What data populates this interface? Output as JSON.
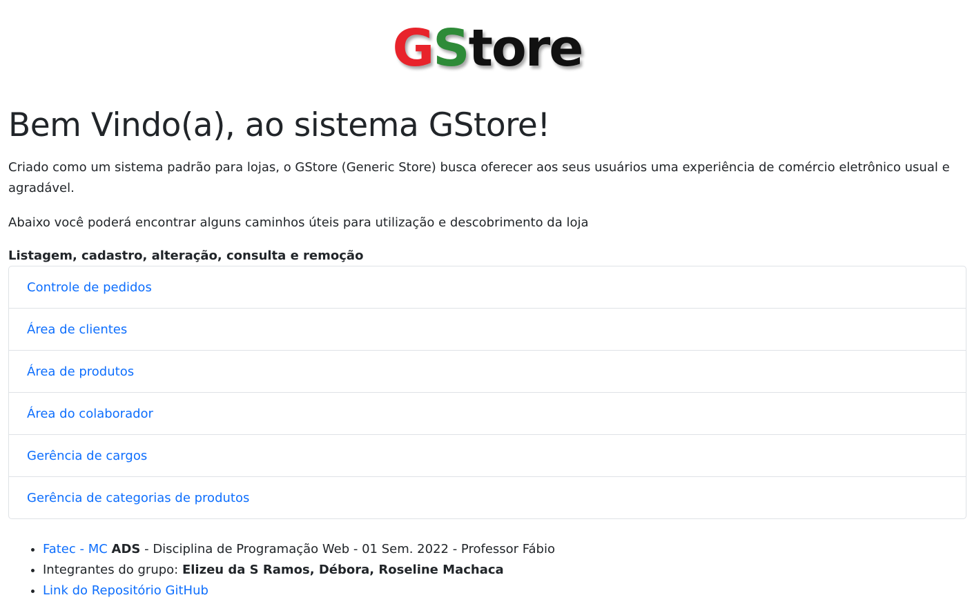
{
  "logo": {
    "g": "G",
    "s": "S",
    "rest": "tore"
  },
  "title": "Bem Vindo(a), ao sistema GStore!",
  "intro": "Criado como um sistema padrão para lojas, o GStore (Generic Store) busca oferecer aos seus usuários uma experiência de comércio eletrônico usual e agradável.",
  "sub": "Abaixo você poderá encontrar alguns caminhos úteis para utilização e descobrimento da loja",
  "section_title": "Listagem, cadastro, alteração, consulta e remoção",
  "links": [
    "Controle de pedidos",
    "Área de clientes",
    "Área de produtos",
    "Área do colaborador",
    "Gerência de cargos",
    "Gerência de categorias de produtos"
  ],
  "footer": {
    "fatec_link": "Fatec - MC",
    "ads": "ADS",
    "discipline": " - Disciplina de Programação Web - 01 Sem. 2022 - Professor Fábio",
    "members_label": "Integrantes do grupo: ",
    "members": "Elizeu da S Ramos, Débora, Roseline Machaca",
    "repo_link": "Link do Repositório GitHub"
  },
  "colors": {
    "link": "#0d6efd",
    "text": "#212529",
    "logo_g": "#e8232b",
    "logo_s": "#2e8b38",
    "border": "#dee2e6"
  }
}
